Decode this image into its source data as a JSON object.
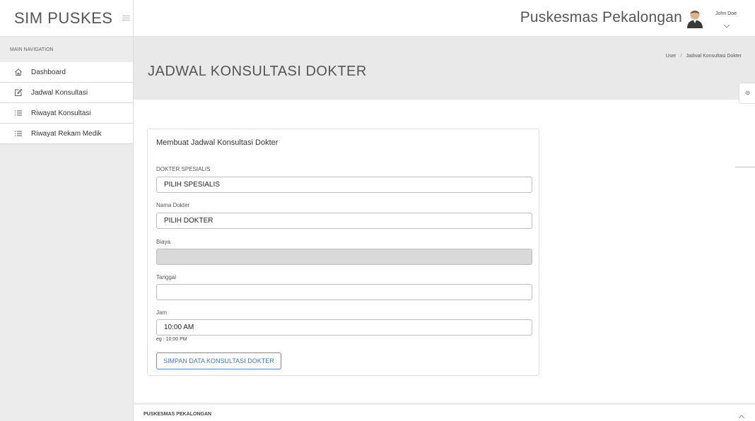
{
  "app": {
    "brand": "SIM PUSKES",
    "organization": "Puskesmas Pekalongan",
    "user_name": "John Doe"
  },
  "sidebar": {
    "header": "MAIN NAVIGATION",
    "items": [
      {
        "label": "Dashboard",
        "icon": "home-icon"
      },
      {
        "label": "Jadwal Konsultasi",
        "icon": "edit-icon"
      },
      {
        "label": "Riwayat Konsultasi",
        "icon": "list-icon"
      },
      {
        "label": "Riwayat Rekam Medik",
        "icon": "list-icon"
      }
    ]
  },
  "content": {
    "title": "JADWAL KONSULTASI DOKTER",
    "breadcrumb": [
      "User",
      "Jadwal Konsultasi Dokter"
    ]
  },
  "form": {
    "title": "Membuat Jadwal Konsultasi Dokter",
    "spesialis_label": "DOKTER SPESIALIS",
    "spesialis_value": "PILIH SPESIALIS",
    "dokter_label": "Nama Dokter",
    "dokter_value": "PILIH DOKTER",
    "biaya_label": "Biaya",
    "biaya_value": "",
    "tanggal_label": "Tanggal",
    "tanggal_value": "",
    "jam_label": "Jam",
    "jam_value": "10:00 AM",
    "jam_help": "eg : 10:00 PM",
    "submit_label": "SIMPAN DATA KONSULTASI DOKTER"
  },
  "footer": {
    "text": "PUSKESMAS PEKALONGAN"
  }
}
